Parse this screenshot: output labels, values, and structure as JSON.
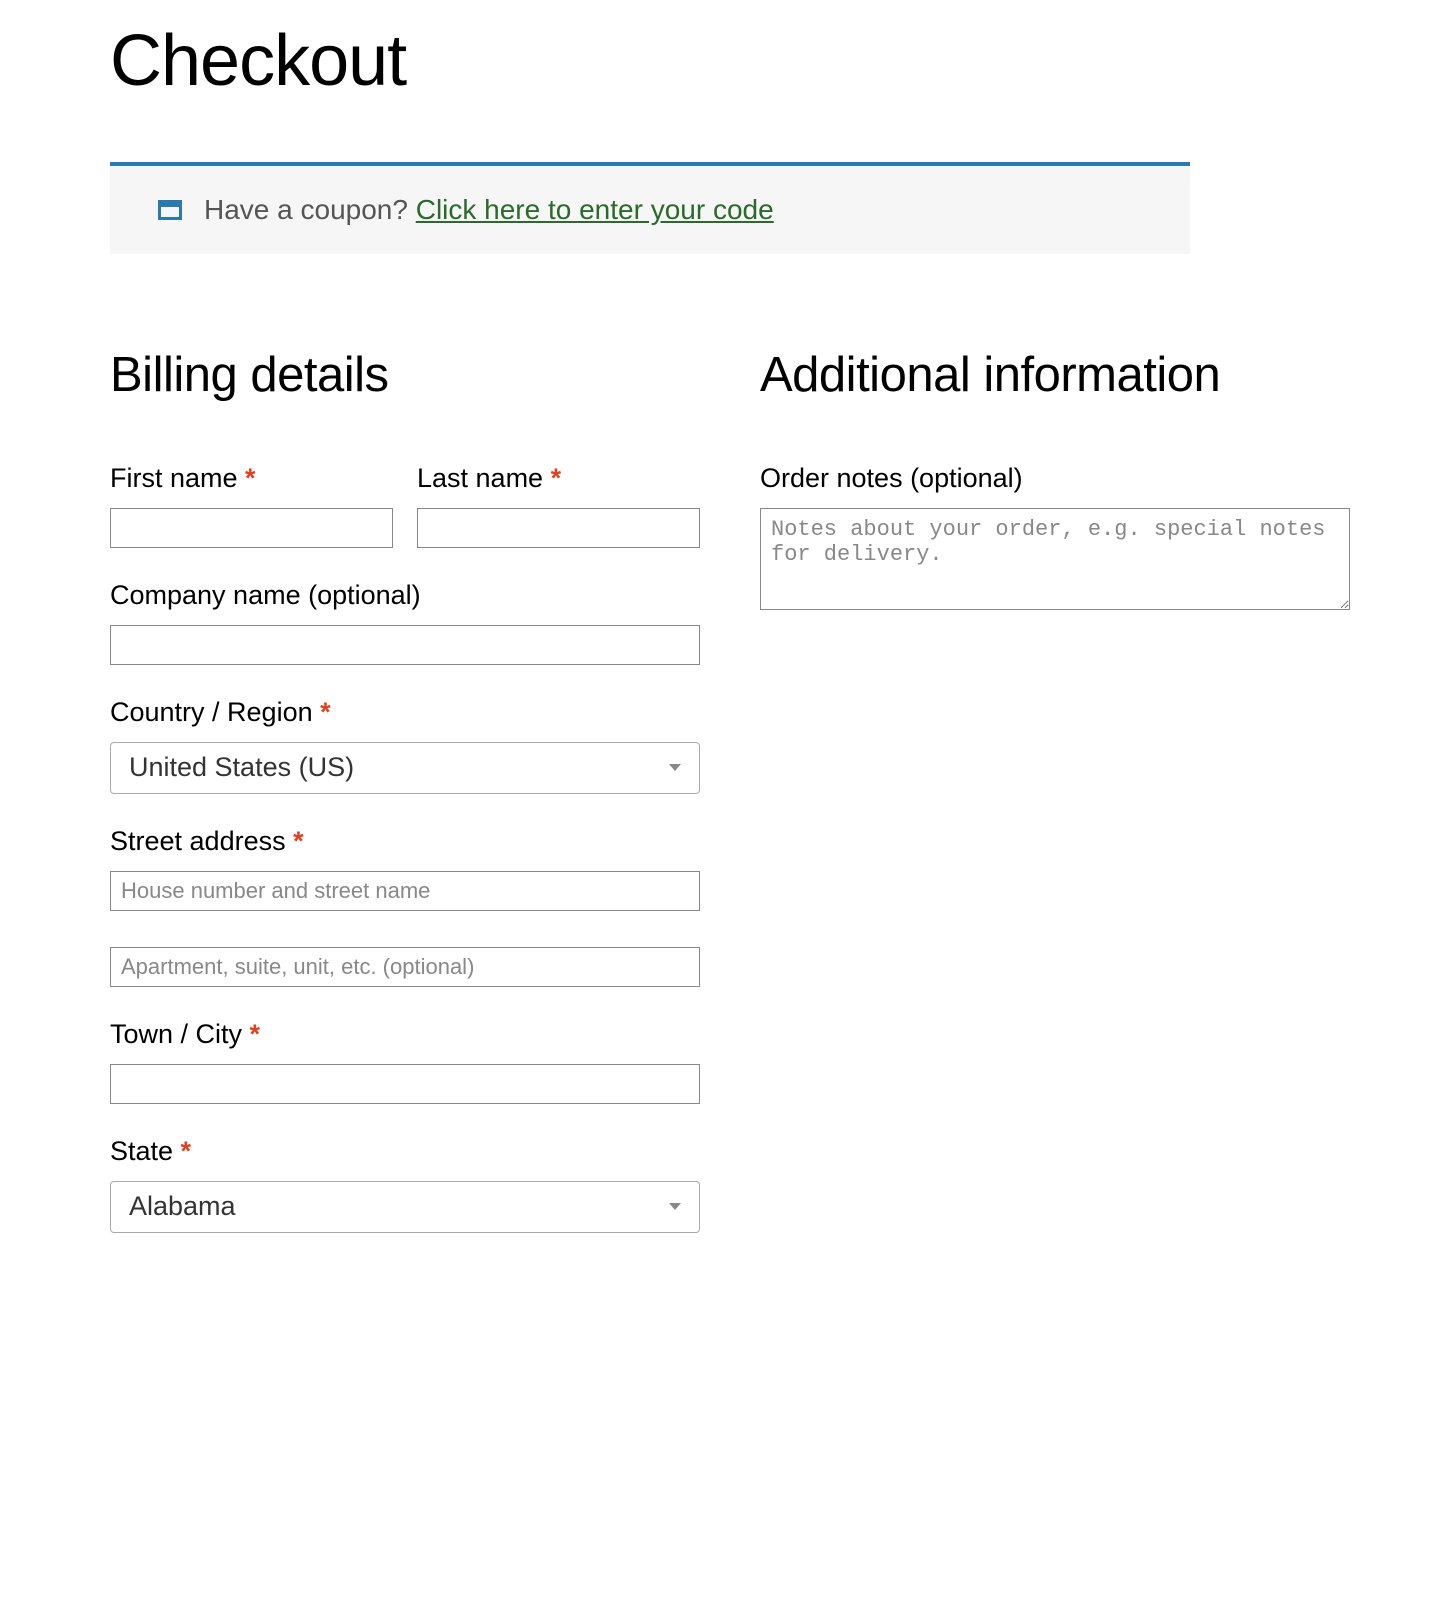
{
  "page": {
    "title": "Checkout"
  },
  "coupon": {
    "prompt": "Have a coupon? ",
    "link_text": "Click here to enter your code"
  },
  "billing": {
    "heading": "Billing details",
    "first_name": {
      "label": "First name ",
      "value": ""
    },
    "last_name": {
      "label": "Last name ",
      "value": ""
    },
    "company": {
      "label": "Company name (optional)",
      "value": ""
    },
    "country": {
      "label": "Country / Region ",
      "value": "United States (US)"
    },
    "street": {
      "label": "Street address ",
      "line1_value": "",
      "line1_placeholder": "House number and street name",
      "line2_value": "",
      "line2_placeholder": "Apartment, suite, unit, etc. (optional)"
    },
    "city": {
      "label": "Town / City ",
      "value": ""
    },
    "state": {
      "label": "State ",
      "value": "Alabama"
    }
  },
  "additional": {
    "heading": "Additional information",
    "order_notes": {
      "label": "Order notes (optional)",
      "value": "",
      "placeholder": "Notes about your order, e.g. special notes for delivery."
    }
  },
  "required_marker": "*"
}
